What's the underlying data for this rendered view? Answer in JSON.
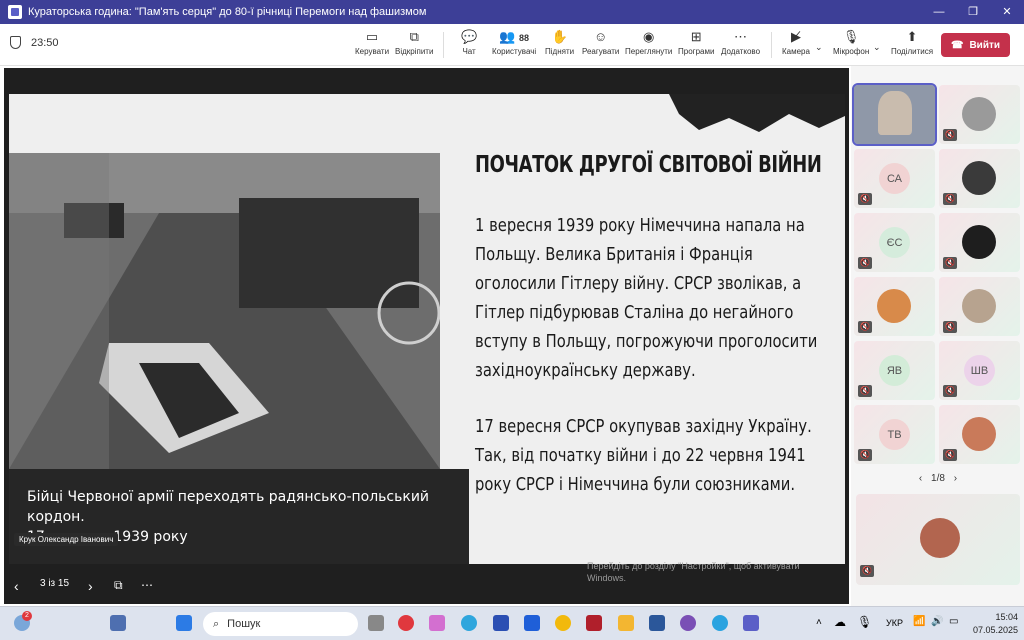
{
  "window": {
    "title": "Кураторська година: \"Пам'ять серця\" до 80-ї річниці Перемоги над фашизмом",
    "minimize": "—",
    "restore": "❐",
    "close": "✕"
  },
  "meeting": {
    "timer": "23:50",
    "toolbar": {
      "control": "Керувати",
      "popout": "Відкріпити",
      "chat": "Чат",
      "people": "Користувачі",
      "people_count": "88",
      "raise": "Підняти",
      "react": "Реагувати",
      "view": "Переглянути",
      "apps": "Програми",
      "more": "Додатково",
      "camera": "Камера",
      "mic": "Мікрофон",
      "share": "Поділитися",
      "leave": "Вийти"
    }
  },
  "slide": {
    "title": "ПОЧАТОК ДРУГОЇ СВІТОВОЇ ВІЙНИ",
    "paragraph1": "1 вересня 1939 року Німеччина напала на Польщу. Велика Британія і Франція оголосили Гітлеру війну. СРСР зволікав, а Гітлер підбурював Сталіна до негайного вступу в Польщу, погрожуючи проголосити західноукраїнську державу.",
    "paragraph2": "17 вересня СРСР окупував західну Україну. Так, від початку війни і до 22 червня 1941 року СРСР і Німеччина були союзниками.",
    "caption_line1": "Бійці Червоної армії переходять радянсько-польський кордон.",
    "caption_line2": "17 вересня 1939 року",
    "watermark_line1": "Перейдіть до розділу \"Настройки\", щоб активувати",
    "watermark_line2": "Windows."
  },
  "presenter_name": "Крук Олександр Іванович",
  "slide_nav": {
    "position": "3 із 15"
  },
  "participants": {
    "tiles": [
      {
        "initials": ""
      },
      {
        "initials": ""
      },
      {
        "initials": "СА"
      },
      {
        "initials": ""
      },
      {
        "initials": "ЄС"
      },
      {
        "initials": ""
      },
      {
        "initials": ""
      },
      {
        "initials": ""
      },
      {
        "initials": "ЯВ"
      },
      {
        "initials": "ШВ"
      },
      {
        "initials": "ТВ"
      },
      {
        "initials": ""
      }
    ],
    "page": "1/8"
  },
  "taskbar": {
    "search_placeholder": "Пошук",
    "lang": "УКР",
    "time": "15:04",
    "date": "07.05.2025",
    "weather_badge": "2"
  },
  "colors": {
    "titlebar": "#3d3f97",
    "leave": "#c4314b",
    "accent": "#5b5fc7"
  }
}
